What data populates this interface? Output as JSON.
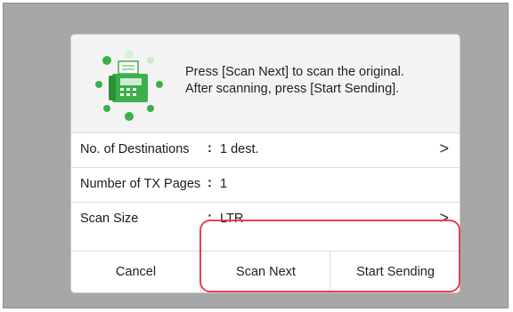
{
  "message": {
    "line1": "Press [Scan Next] to scan the original.",
    "line2": "After scanning, press [Start Sending]."
  },
  "rows": [
    {
      "label": "No. of Destinations",
      "separator": ":",
      "value": "1 dest.",
      "chevron": ">"
    },
    {
      "label": "Number of TX Pages",
      "separator": ":",
      "value": "1"
    },
    {
      "label": "Scan Size",
      "separator": ":",
      "value": "LTR",
      "chevron": ">"
    }
  ],
  "buttons": {
    "cancel": "Cancel",
    "scan_next": "Scan Next",
    "start_sending": "Start Sending"
  },
  "icon": "fax-machine-icon",
  "colors": {
    "icon_green": "#3bb04a",
    "highlight_red": "#e8434a",
    "screen_gray": "#a7a7a7"
  }
}
